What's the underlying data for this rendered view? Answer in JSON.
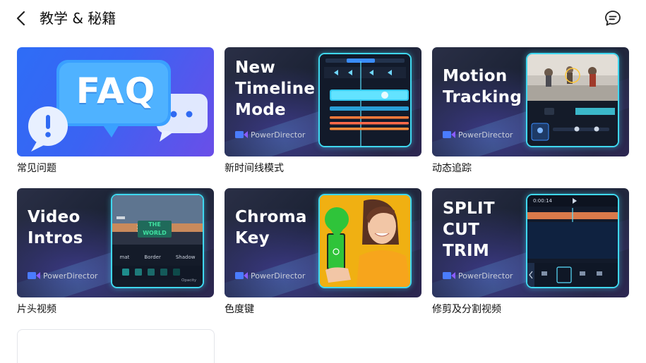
{
  "header": {
    "title": "教学 & 秘籍",
    "back_icon": "chevron-left-icon",
    "feedback_icon": "chat-bubble-icon"
  },
  "tutorials": [
    {
      "caption": "常见问题",
      "thumb_text": "FAQ"
    },
    {
      "caption": "新时间线模式",
      "thumb_title": "New\nTimeline\nMode",
      "brand": "PowerDirector"
    },
    {
      "caption": "动态追踪",
      "thumb_title": "Motion\nTracking",
      "brand": "PowerDirector"
    },
    {
      "caption": "片头视频",
      "thumb_title": "Video\nIntros",
      "brand": "PowerDirector",
      "phone_tabs": [
        "mat",
        "Border",
        "Shadow"
      ],
      "phone_label": "Opacity",
      "banner": "THE WORLD"
    },
    {
      "caption": "色度键",
      "thumb_title": "Chroma\nKey",
      "brand": "PowerDirector"
    },
    {
      "caption": "修剪及分割视频",
      "thumb_title": "SPLIT\nCUT\nTRIM",
      "brand": "PowerDirector",
      "timecode": "0:00:14"
    }
  ],
  "colors": {
    "accent_cyan": "#3fd8f0",
    "faq_blue": "#2e6df6",
    "chroma_green": "#2fc43a",
    "chroma_yellow": "#f0b012"
  }
}
